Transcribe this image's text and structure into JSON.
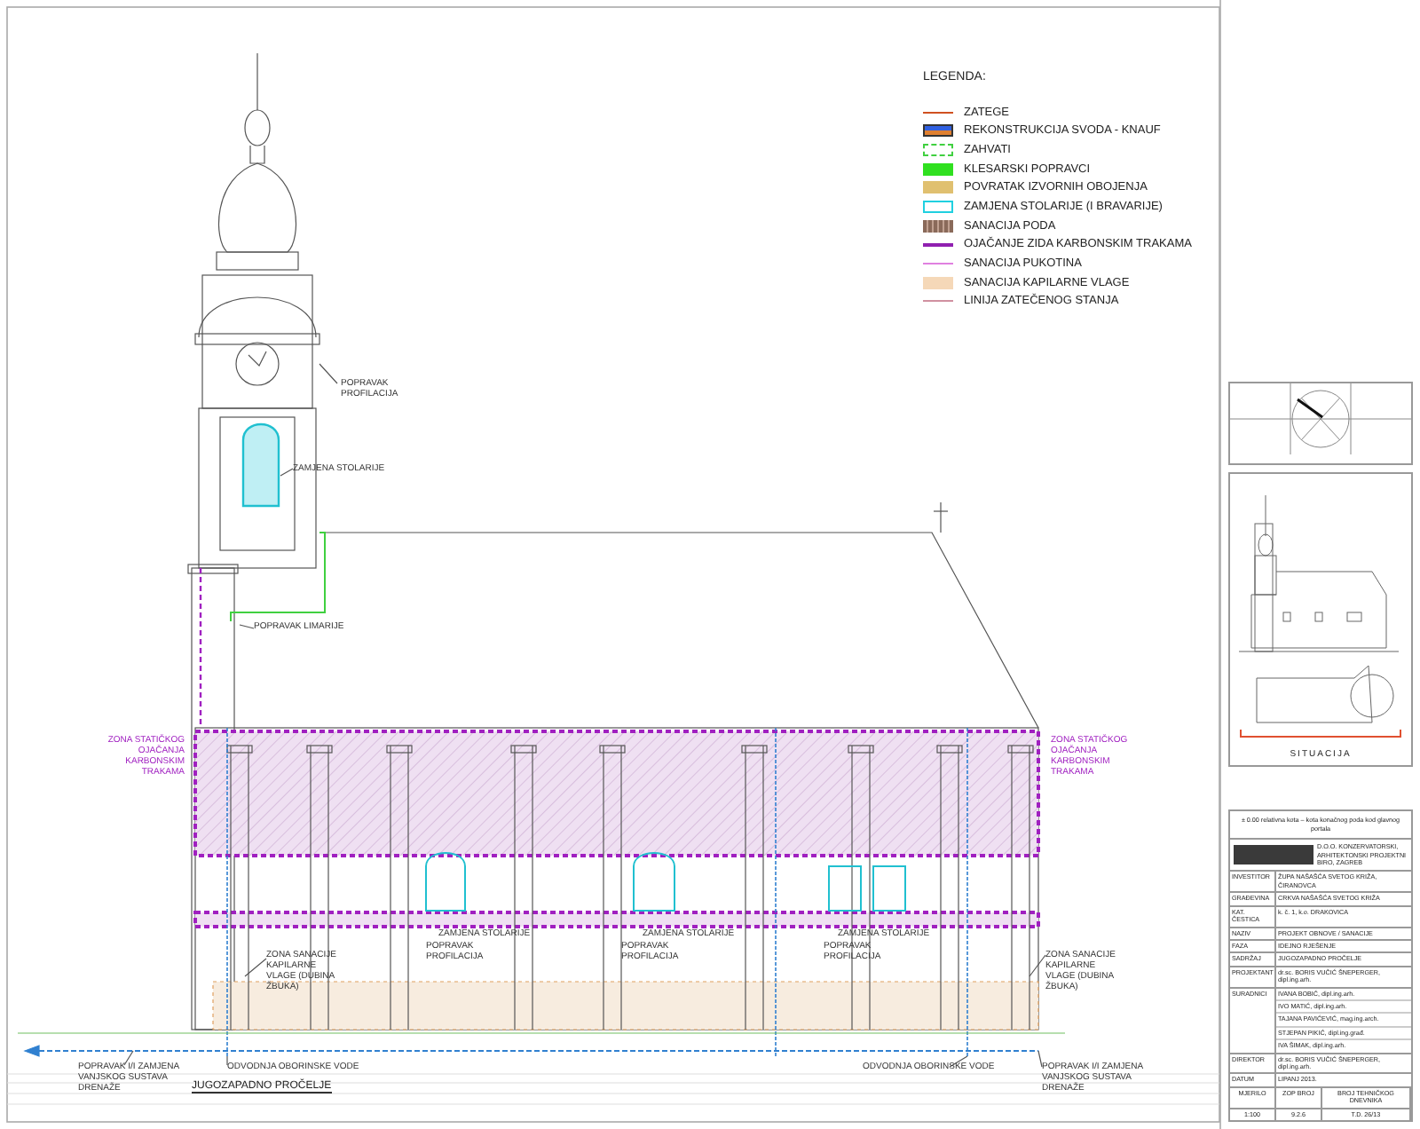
{
  "legend": {
    "title": "LEGENDA:",
    "items": [
      {
        "label": "ZATEGE",
        "kind": "tie"
      },
      {
        "label": "REKONSTRUKCIJA SVODA - KNAUF",
        "kind": "vault"
      },
      {
        "label": "ZAHVATI",
        "kind": "intervention"
      },
      {
        "label": "KLESARSKI POPRAVCI",
        "kind": "stonework"
      },
      {
        "label": "POVRATAK IZVORNIH OBOJENJA",
        "kind": "render"
      },
      {
        "label": "ZAMJENA STOLARIJE (I BRAVARIJE)",
        "kind": "joinery"
      },
      {
        "label": "SANACIJA PODA",
        "kind": "floor"
      },
      {
        "label": "OJAČANJE ZIDA KARBONSKIM TRAKAMA",
        "kind": "carbon"
      },
      {
        "label": "SANACIJA PUKOTINA",
        "kind": "crack"
      },
      {
        "label": "SANACIJA KAPILARNE VLAGE",
        "kind": "moisture"
      },
      {
        "label": "LINIJA ZATEČENOG STANJA",
        "kind": "existing"
      }
    ]
  },
  "annotations": [
    {
      "text": "POPRAVAK PROFILACIJA",
      "kind": "note"
    },
    {
      "text": "ZAMJENA STOLARIJE",
      "kind": "note"
    },
    {
      "text": "POPRAVAK LIMARIJE",
      "kind": "note"
    },
    {
      "text": "ZONA STATIČKOG OJAČANJA KARBONSKIM TRAKAMA",
      "kind": "zone"
    },
    {
      "text": "ZONA STATIČKOG OJAČANJA KARBONSKIM TRAKAMA",
      "kind": "zone"
    },
    {
      "text": "ZAMJENA STOLARIJE",
      "kind": "note"
    },
    {
      "text": "POPRAVAK PROFILACIJA",
      "kind": "note"
    },
    {
      "text": "ZAMJENA STOLARIJE",
      "kind": "note"
    },
    {
      "text": "POPRAVAK PROFILACIJA",
      "kind": "note"
    },
    {
      "text": "ZAMJENA STOLARIJE",
      "kind": "note"
    },
    {
      "text": "POPRAVAK PROFILACIJA",
      "kind": "note"
    },
    {
      "text": "ZONA SANACIJE KAPILARNE VLAGE (DUBINA ŽBUKA)",
      "kind": "note"
    },
    {
      "text": "ZONA SANACIJE KAPILARNE VLAGE (DUBINA ŽBUKA)",
      "kind": "note"
    },
    {
      "text": "POPRAVAK I/I ZAMJENA VANJSKOG SUSTAVA DRENAŽE",
      "kind": "note"
    },
    {
      "text": "ODVODNJA OBORINSKE VODE",
      "kind": "note"
    },
    {
      "text": "ODVODNJA OBORINSKE VODE",
      "kind": "note"
    },
    {
      "text": "POPRAVAK I/I ZAMJENA VANJSKOG SUSTAVA DRENAŽE",
      "kind": "note"
    }
  ],
  "drawing_title": "JUGOZAPADNO PROČELJE",
  "situation": {
    "label": "SITUACIJA"
  },
  "title_block": {
    "note": "± 0.00 relativna kota – kota konačnog poda kod glavnog portala",
    "company": "D.O.O. KONZERVATORSKI, ARHITEKTONSKI PROJEKTNI BIRO, ZAGREB",
    "rows": [
      {
        "label": "INVESTITOR",
        "values": [
          "ŽUPA NAŠAŠĆA SVETOG KRIŽA, ČIRANOVCA"
        ]
      },
      {
        "label": "GRAĐEVINA",
        "values": [
          "CRKVA NAŠAŠĆA SVETOG KRIŽA"
        ]
      },
      {
        "label": "KAT. ČESTICA",
        "values": [
          "k. č. 1, k.o. DRAKOVICA"
        ]
      },
      {
        "label": "NAZIV",
        "values": [
          "PROJEKT OBNOVE / SANACIJE"
        ]
      },
      {
        "label": "FAZA",
        "values": [
          "IDEJNO RJEŠENJE"
        ]
      },
      {
        "label": "SADRŽAJ",
        "values": [
          "JUGOZAPADNO PROČELJE"
        ]
      },
      {
        "label": "PROJEKTANT",
        "values": [
          "dr.sc. BORIS VUČIĆ ŠNEPERGER, dipl.ing.arh."
        ]
      },
      {
        "label": "SURADNICI",
        "values": [
          "IVANA BOBIĆ, dipl.ing.arh.",
          "IVO MATIĆ, dipl.ing.arh.",
          "TAJANA PAVIĆEVIĆ, mag.ing.arch.",
          "STJEPAN PIKIĆ, dipl.ing.građ.",
          "IVA ŠIMAK, dipl.ing.arh."
        ]
      },
      {
        "label": "DIREKTOR",
        "values": [
          "dr.sc. BORIS VUČIĆ ŠNEPERGER, dipl.ing.arh."
        ]
      },
      {
        "label": "DATUM",
        "values": [
          "LIPANJ 2013."
        ]
      }
    ],
    "footer_headings": [
      "MJERILO",
      "ZOP BROJ",
      "BROJ TEHNIČKOG DNEVNIKA"
    ],
    "footer_values": [
      "1:100",
      "9.2.6",
      "T.D. 26/13"
    ]
  }
}
